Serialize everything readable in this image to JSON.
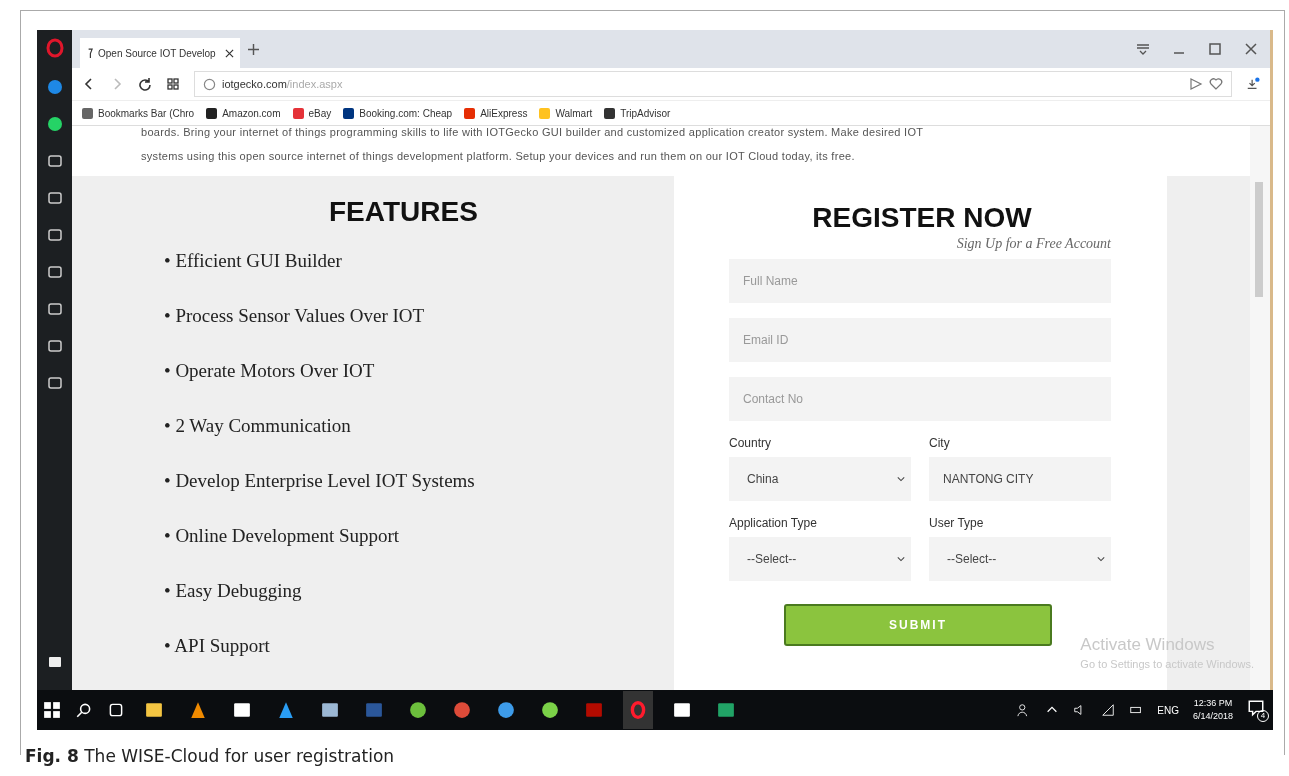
{
  "browser": {
    "tab_title": "Open Source IOT Develop",
    "address_host": "iotgecko.com",
    "address_path": "/index.aspx",
    "bookmarks": [
      {
        "kind": "folder",
        "label": "Bookmarks Bar (Chro"
      },
      {
        "kind": "amazon",
        "label": "Amazon.com"
      },
      {
        "kind": "ebay",
        "label": "eBay"
      },
      {
        "kind": "booking",
        "label": "Booking.com: Cheap"
      },
      {
        "kind": "aliexpress",
        "label": "AliExpress"
      },
      {
        "kind": "walmart",
        "label": "Walmart"
      },
      {
        "kind": "tripadvisor",
        "label": "TripAdvisor"
      }
    ]
  },
  "page": {
    "intro": [
      "boards. Bring your internet of things programming skills to life with IOTGecko GUI builder and customized application creator system. Make desired IOT",
      "systems using this open source internet of things development platform. Setup your devices and run them on our IOT Cloud today, its free."
    ],
    "features": {
      "title": "FEATURES",
      "items": [
        "• Efficient GUI Builder",
        "• Process Sensor Values Over IOT",
        "• Operate Motors Over IOT",
        "• 2 Way Communication",
        "• Develop Enterprise Level IOT Systems",
        "• Online Development Support",
        "• Easy Debugging",
        "• API Support"
      ]
    },
    "register": {
      "title": "REGISTER NOW",
      "subtitle": "Sign Up for a Free Account",
      "fields": [
        {
          "placeholder": "Full Name"
        },
        {
          "placeholder": "Email ID"
        },
        {
          "placeholder": "Contact No"
        }
      ],
      "pairs": [
        [
          {
            "label": "Country",
            "kind": "select",
            "value": "China"
          },
          {
            "label": "City",
            "kind": "text",
            "value": "NANTONG CITY"
          }
        ],
        [
          {
            "label": "Application Type",
            "kind": "select",
            "value": "--Select--"
          },
          {
            "label": "User Type",
            "kind": "select",
            "value": "--Select--"
          }
        ]
      ],
      "submit": "SUBMIT"
    }
  },
  "activation": {
    "title": "Activate Windows",
    "text": "Go to Settings to activate Windows."
  },
  "taskbar": {
    "lang": "ENG",
    "time": "12:36 PM",
    "date": "6/14/2018",
    "notifications": "4"
  },
  "caption": {
    "label": "Fig. 8",
    "text": "The WISE-Cloud for user registration"
  }
}
